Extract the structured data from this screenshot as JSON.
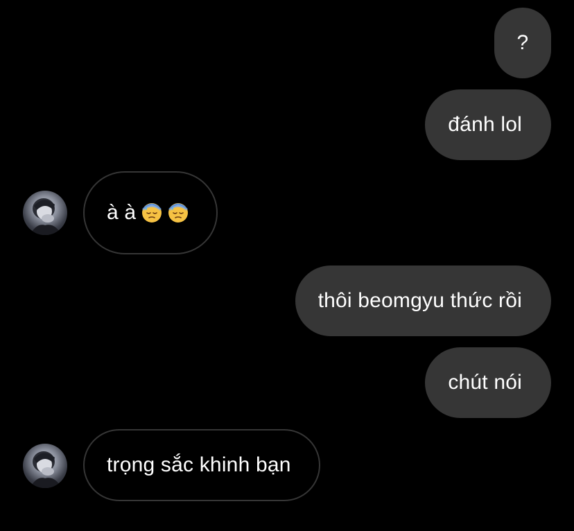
{
  "messages": [
    {
      "direction": "sent",
      "text": "?"
    },
    {
      "direction": "sent",
      "text": "đánh lol"
    },
    {
      "direction": "received",
      "text": "à à",
      "emojis": [
        "downcast-face-with-sweat",
        "downcast-face-with-sweat"
      ]
    },
    {
      "direction": "sent",
      "text": "thôi beomgyu thức rồi"
    },
    {
      "direction": "sent",
      "text": "chút nói"
    },
    {
      "direction": "received",
      "text": "trọng sắc khinh bạn"
    }
  ],
  "colors": {
    "background": "#000000",
    "sent_bubble": "#363636",
    "received_border": "#363636",
    "text": "#ffffff"
  }
}
